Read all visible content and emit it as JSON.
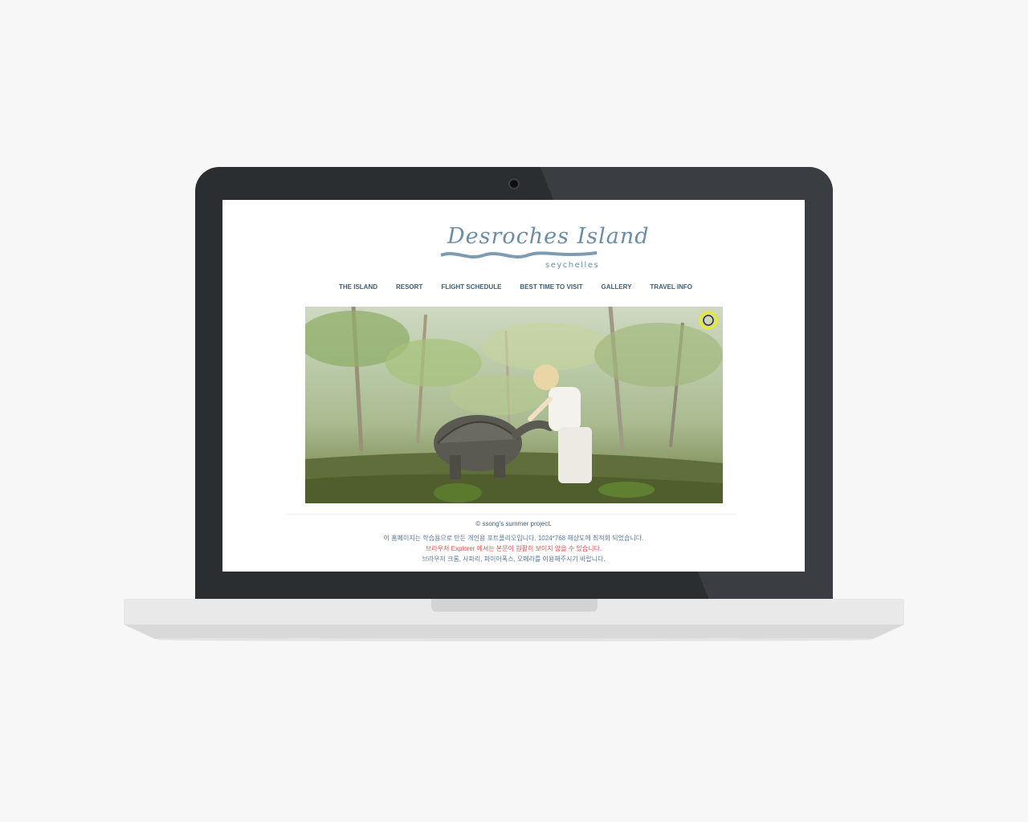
{
  "site": {
    "logo": {
      "title": "Desroches Island",
      "subtitle": "seychelles"
    },
    "nav": [
      {
        "label": "THE ISLAND"
      },
      {
        "label": "RESORT"
      },
      {
        "label": "FLIGHT SCHEDULE"
      },
      {
        "label": "BEST TIME TO VISIT"
      },
      {
        "label": "GALLERY"
      },
      {
        "label": "TRAVEL INFO"
      }
    ],
    "footer": {
      "copyright": "© ssong's summer project.",
      "line1": "이 홈페이지는 학습용으로 만든 개인용 포트폴리오입니다. 1024*768 해상도에 최적화 되었습니다.",
      "line2": "브라우저 Explorer 에서는 본문이 원활히 보이지 않을 수 있습니다.",
      "line3": "브라우저 크롬, 사파리, 파이어폭스, 오페라를 이용해주시기 바랍니다."
    }
  },
  "colors": {
    "page_bg": "#f7f7f7",
    "laptop_bezel": "#2b2e31",
    "nav_text": "#3f5d77",
    "logo": "#6b8ea8",
    "notice_red": "#d9534f"
  },
  "icons": [
    "camera-icon",
    "slide-toggle-icon"
  ]
}
